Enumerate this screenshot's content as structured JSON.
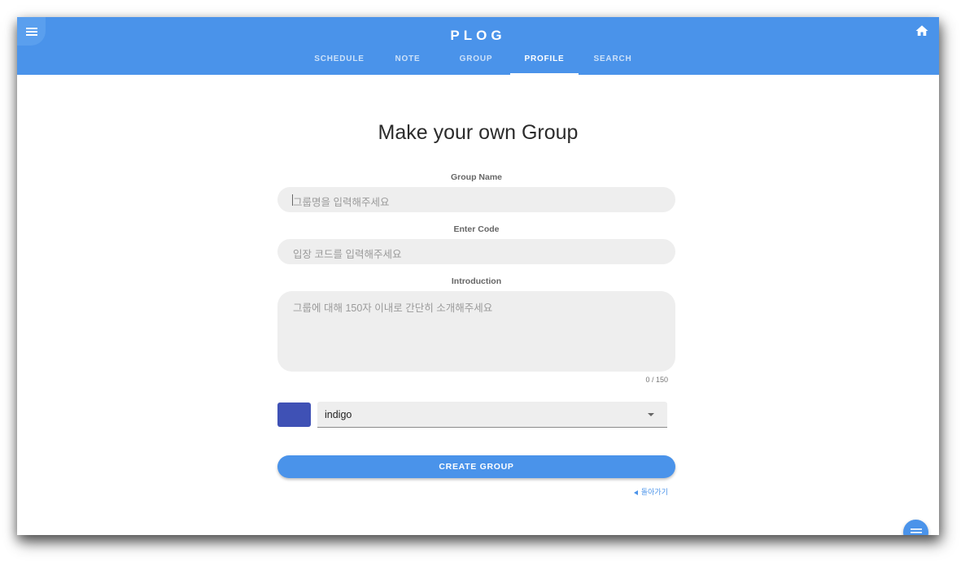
{
  "header": {
    "brand": "PLOG",
    "menu_icon": "hamburger-menu-icon",
    "home_icon": "home-icon",
    "tabs": [
      {
        "label": "SCHEDULE"
      },
      {
        "label": "NOTE"
      },
      {
        "label": "GROUP"
      },
      {
        "label": "PROFILE",
        "active": true
      },
      {
        "label": "SEARCH"
      }
    ]
  },
  "form": {
    "title": "Make your own Group",
    "group_name": {
      "label": "Group Name",
      "placeholder": "그룹명을 입력해주세요",
      "value": ""
    },
    "code": {
      "label": "Enter Code",
      "placeholder": "입장 코드를 입력해주세요",
      "value": ""
    },
    "introduction": {
      "label": "Introduction",
      "placeholder": "그룹에 대해 150자 이내로 간단히 소개해주세요",
      "value": "",
      "counter": "0 / 150"
    },
    "color": {
      "selected": "indigo",
      "swatch_color": "#3f51b5"
    },
    "submit_label": "CREATE GROUP",
    "back_label": "돌아가기"
  },
  "fab_icon": "menu-lines-icon",
  "colors": {
    "primary": "#4a93ea",
    "field_bg": "#eeeeee"
  }
}
